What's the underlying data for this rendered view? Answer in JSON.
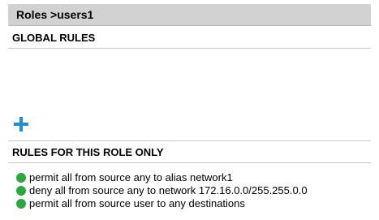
{
  "header": {
    "title": "Roles >users1"
  },
  "global_rules": {
    "title": "GLOBAL RULES",
    "add_icon": "plus-icon"
  },
  "role_rules": {
    "title": "RULES FOR THIS ROLE ONLY",
    "status_icon": "green-dot-icon",
    "status_color": "#2aa839",
    "items": [
      {
        "label": "permit all from source any to alias network1"
      },
      {
        "label": "deny all from source any to network 172.16.0.0/255.255.0.0"
      },
      {
        "label": "permit all from source user to any destinations"
      }
    ]
  },
  "colors": {
    "header_bg": "#d2d2d2",
    "divider": "#c9c9c9",
    "accent_blue": "#1e8fd6",
    "status_green": "#2aa839"
  }
}
